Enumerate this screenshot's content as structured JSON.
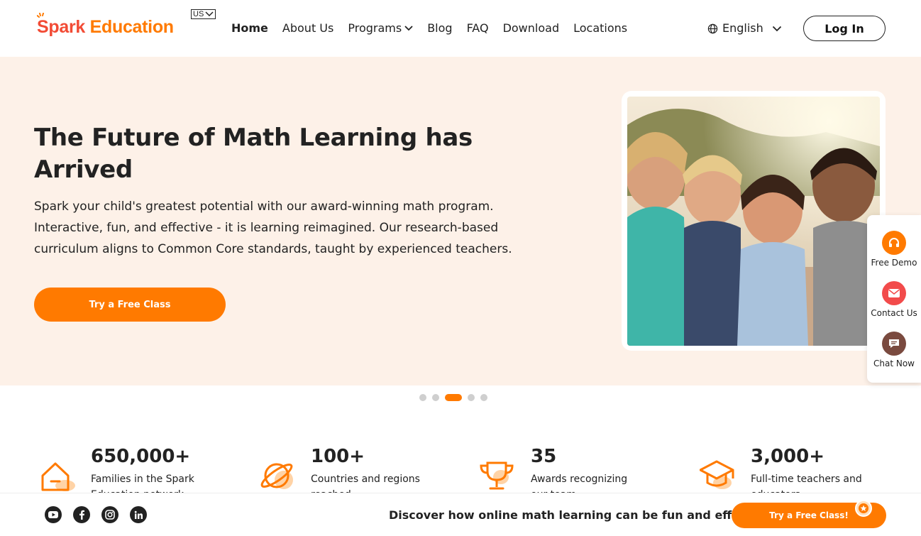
{
  "header": {
    "logo": {
      "part1": "Spark",
      "part2": " Education"
    },
    "region": "US",
    "nav": [
      {
        "label": "Home",
        "active": true
      },
      {
        "label": "About Us"
      },
      {
        "label": "Programs",
        "dropdown": true
      },
      {
        "label": "Blog"
      },
      {
        "label": "FAQ"
      },
      {
        "label": "Download"
      },
      {
        "label": "Locations"
      }
    ],
    "language": "English",
    "login_label": "Log In"
  },
  "hero": {
    "title": "The Future of Math Learning has Arrived",
    "description": "Spark your child's greatest potential with our award-winning math program. Interactive, fun, and effective - it is learning reimagined. Our research-based curriculum aligns to Common Core standards, taught by experienced teachers.",
    "cta_label": "Try a Free Class",
    "carousel": {
      "slides": 5,
      "active": 3
    }
  },
  "side_widget": [
    {
      "label": "Free Demo",
      "icon": "headset-icon",
      "color": "#ff7a00"
    },
    {
      "label": "Contact Us",
      "icon": "mail-icon",
      "color": "#f24b4b"
    },
    {
      "label": "Chat Now",
      "icon": "chat-icon",
      "color": "#7a4a3f"
    }
  ],
  "stats": [
    {
      "number": "650,000+",
      "text": "Families in the Spark Education network",
      "icon": "home-icon"
    },
    {
      "number": "100+",
      "text": "Countries and regions reached",
      "icon": "planet-icon"
    },
    {
      "number": "35",
      "text": "Awards recognizing our team",
      "icon": "trophy-icon"
    },
    {
      "number": "3,000+",
      "text": "Full-time teachers and educators",
      "icon": "graduation-cap-icon"
    }
  ],
  "footer_bar": {
    "social": [
      {
        "name": "youtube-icon"
      },
      {
        "name": "facebook-icon"
      },
      {
        "name": "instagram-icon"
      },
      {
        "name": "linkedin-icon"
      }
    ],
    "message": "Discover how online math learning can be fun and effective",
    "cta_label": "Try a Free Class!"
  },
  "colors": {
    "brand_orange": "#ff7a00",
    "brand_red": "#f24b35",
    "hero_bg": "#fdf1e8"
  }
}
